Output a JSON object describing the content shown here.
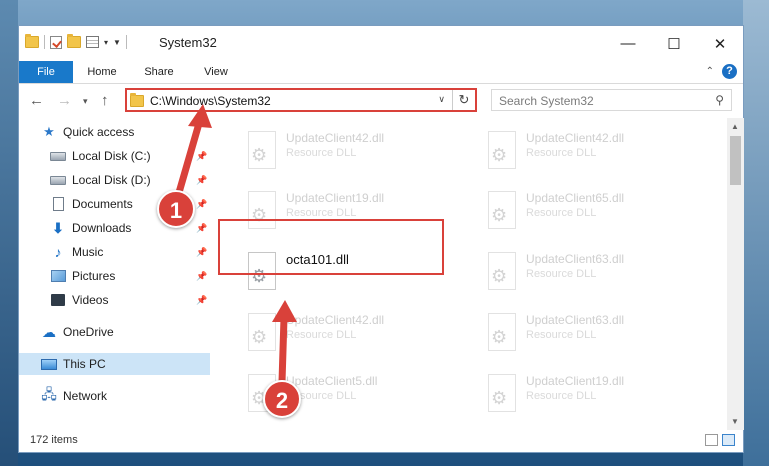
{
  "window": {
    "title": "System32",
    "controls": {
      "minimize": "—",
      "maximize": "☐",
      "close": "✕"
    }
  },
  "ribbon": {
    "tabs": [
      "File",
      "Home",
      "Share",
      "View"
    ]
  },
  "address": {
    "path": "C:\\Windows\\System32"
  },
  "search": {
    "placeholder": "Search System32"
  },
  "nav": {
    "items": [
      {
        "label": "Quick access",
        "icon": "star-icon"
      },
      {
        "label": "Local Disk (C:)",
        "icon": "drive-icon",
        "pinned": true
      },
      {
        "label": "Local Disk (D:)",
        "icon": "drive-icon",
        "pinned": true
      },
      {
        "label": "Documents",
        "icon": "documents-icon",
        "pinned": true
      },
      {
        "label": "Downloads",
        "icon": "downloads-icon",
        "pinned": true
      },
      {
        "label": "Music",
        "icon": "music-icon",
        "pinned": true
      },
      {
        "label": "Pictures",
        "icon": "pictures-icon",
        "pinned": true
      },
      {
        "label": "Videos",
        "icon": "videos-icon",
        "pinned": true
      },
      {
        "label": "OneDrive",
        "icon": "onedrive-icon"
      },
      {
        "label": "This PC",
        "icon": "this-pc-icon",
        "selected": true
      },
      {
        "label": "Network",
        "icon": "network-icon"
      }
    ]
  },
  "files": {
    "left": [
      {
        "name": "UpdateClient42.dll",
        "type": "Resource DLL"
      },
      {
        "name": "UpdateClient19.dll",
        "type": "Resource DLL"
      },
      {
        "name": "octa101.dll",
        "type": "",
        "highlighted": true
      },
      {
        "name": "UpdateClient42.dll",
        "type": "Resource DLL"
      },
      {
        "name": "UpdateClient5.dll",
        "type": "Resource DLL"
      }
    ],
    "right": [
      {
        "name": "UpdateClient42.dll",
        "type": "Resource DLL"
      },
      {
        "name": "UpdateClient65.dll",
        "type": "Resource DLL"
      },
      {
        "name": "UpdateClient63.dll",
        "type": "Resource DLL"
      },
      {
        "name": "UpdateClient63.dll",
        "type": "Resource DLL"
      },
      {
        "name": "UpdateClient19.dll",
        "type": "Resource DLL"
      }
    ]
  },
  "status": {
    "item_count": "172 items"
  },
  "annotations": {
    "callout1": "1",
    "callout2": "2",
    "color": "#d9413a"
  }
}
